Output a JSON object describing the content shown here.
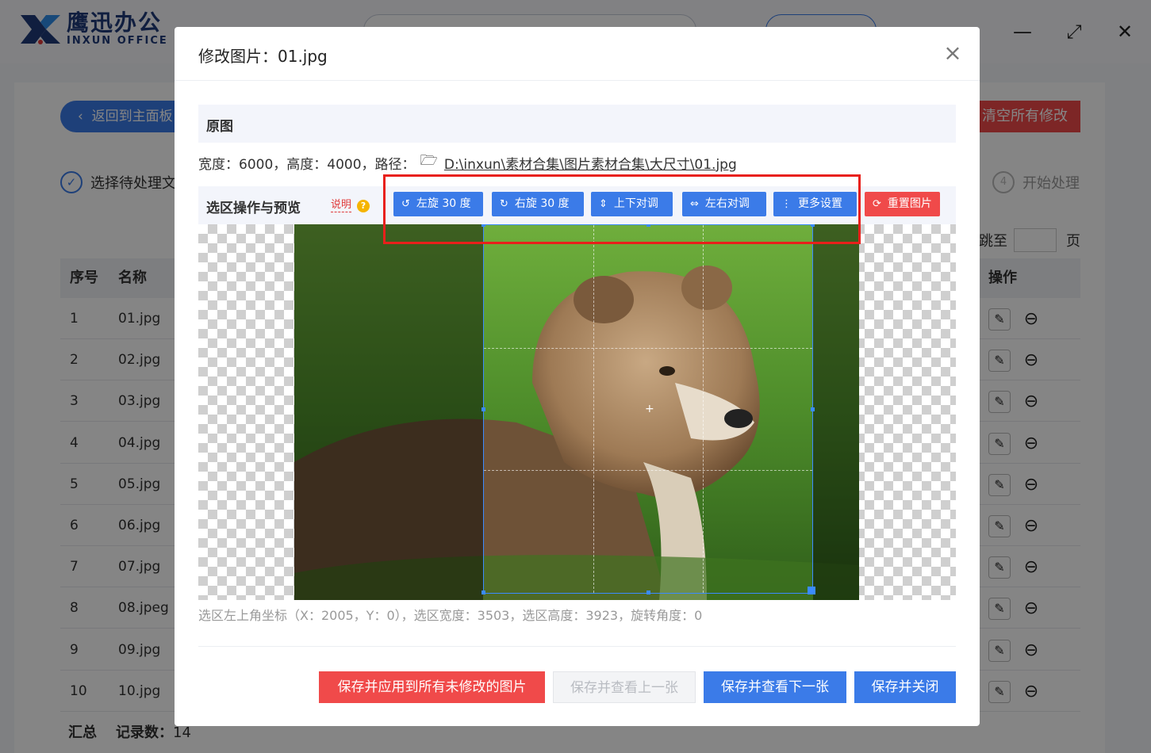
{
  "app": {
    "logo_cn": "鹰迅办公",
    "logo_en": "INXUN OFFICE",
    "window_controls": {
      "minimize": "—",
      "maximize": "⤢",
      "close": "✕"
    },
    "back_label": "返回到主面板",
    "clear_label": "清空所有修改",
    "step1_label": "选择待处理文",
    "step4_num": "4",
    "step4_label": "开始处理",
    "jump_label": "跳至",
    "page_label": "页",
    "table": {
      "headers": {
        "index": "序号",
        "name": "名称",
        "ops": "操作"
      },
      "rows": [
        {
          "index": "1",
          "name": "01.jpg"
        },
        {
          "index": "2",
          "name": "02.jpg"
        },
        {
          "index": "3",
          "name": "03.jpg"
        },
        {
          "index": "4",
          "name": "04.jpg"
        },
        {
          "index": "5",
          "name": "05.jpg"
        },
        {
          "index": "6",
          "name": "06.jpg"
        },
        {
          "index": "7",
          "name": "07.jpg"
        },
        {
          "index": "8",
          "name": "08.jpeg"
        },
        {
          "index": "9",
          "name": "09.jpg"
        },
        {
          "index": "10",
          "name": "10.jpg"
        }
      ]
    },
    "summary": {
      "total_label": "汇总",
      "records_label": "记录数：",
      "records_value": "14"
    }
  },
  "dialog": {
    "title": "修改图片：01.jpg",
    "close_symbol": "×",
    "original_section": "原图",
    "info": {
      "width_text": "宽度：6000，高度：4000，路径：",
      "path": "D:\\inxun\\素材合集\\图片素材合集\\大尺寸\\01.jpg"
    },
    "preview_section": "选区操作与预览",
    "help_label": "说明",
    "help_icon": "?",
    "toolbar": [
      {
        "name": "rotate-left-button",
        "icon": "↺",
        "label": "左旋 30 度"
      },
      {
        "name": "rotate-right-button",
        "icon": "↻",
        "label": "右旋 30 度"
      },
      {
        "name": "flip-vertical-button",
        "icon": "⇕",
        "label": "上下对调"
      },
      {
        "name": "flip-horizontal-button",
        "icon": "⇔",
        "label": "左右对调"
      },
      {
        "name": "more-settings-button",
        "icon": "⋮",
        "label": "更多设置"
      }
    ],
    "reset_label": "重置图片",
    "reset_icon": "⟳",
    "crosshair": "+",
    "coords_text": "选区左上角坐标（X：2005，Y：0），选区宽度：3503，选区高度：3923，旋转角度：0",
    "footer": {
      "apply_all": "保存并应用到所有未修改的图片",
      "prev": "保存并查看上一张",
      "next": "保存并查看下一张",
      "close": "保存并关闭"
    }
  },
  "colors": {
    "primary": "#3b7be8",
    "danger": "#f04a4a",
    "highlight": "#e8201b"
  }
}
